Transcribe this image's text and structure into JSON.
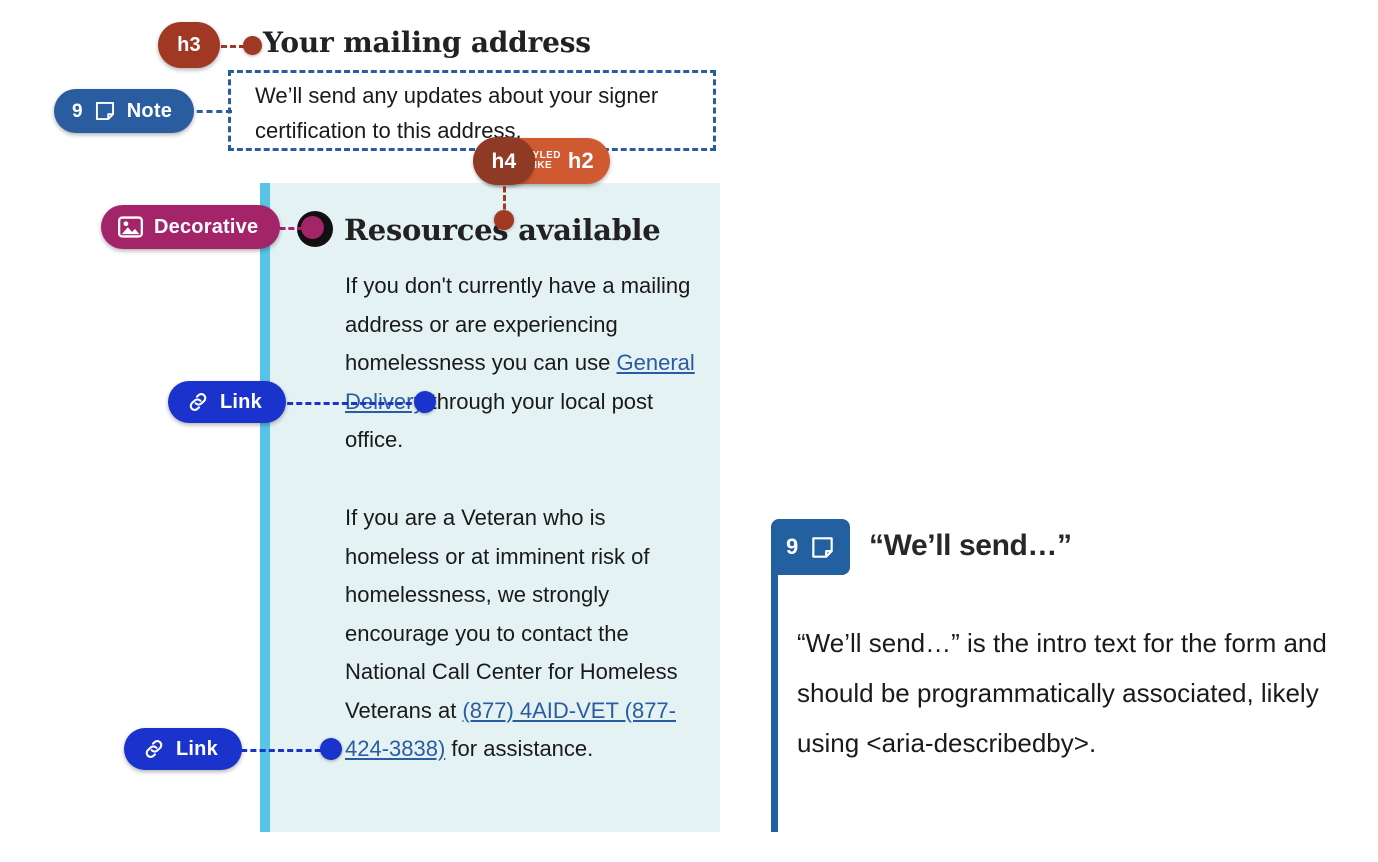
{
  "page": {
    "heading_h3": "Your mailing address",
    "note_box_text": "We’ll send any updates about your signer certification to this address.",
    "heading_h4": "Resources available",
    "paragraph_1_before_link": "If you don't currently have a mailing address or are experiencing homelessness you can use ",
    "paragraph_1_link": "General Delivery",
    "paragraph_1_after_link": " through your local post office.",
    "paragraph_2_before_link": "If you are a Veteran who is homeless or at imminent risk of homelessness, we strongly encourage you to contact the National Call Center for Homeless Veterans at ",
    "paragraph_2_link": "(877) 4AID-VET (877-424-3838)",
    "paragraph_2_after_link": " for assistance."
  },
  "annotations": {
    "h3_badge": {
      "label": "h3",
      "color": "#a03823",
      "icon": "none"
    },
    "note_badge": {
      "number": "9",
      "label": "Note",
      "icon": "note-icon",
      "color": "#2a5ca0"
    },
    "h4_badge": {
      "label": "h4",
      "color": "#8f3a25"
    },
    "styled_like_badge": {
      "line1": "STYLED",
      "line2": "LIKE",
      "label": "h2",
      "color": "#cf5a31"
    },
    "decorative_badge": {
      "label": "Decorative",
      "icon": "image-icon",
      "color": "#a4246a"
    },
    "link_badge_1": {
      "label": "Link",
      "icon": "link-icon",
      "color": "#1a33cc"
    },
    "link_badge_2": {
      "label": "Link",
      "icon": "link-icon",
      "color": "#1a33cc"
    }
  },
  "note_card": {
    "number": "9",
    "icon": "note-icon",
    "title": "“We’ll send…”",
    "body": "“We’ll send…” is the intro text for the form and should be programmatically associated, likely using <aria-describedby>.",
    "accent_color": "#23609f"
  },
  "colors": {
    "panel_background": "#e4f2f4",
    "panel_stripe": "#57c4e8",
    "link_text": "#2a5ca0",
    "heading_text": "#222222"
  }
}
